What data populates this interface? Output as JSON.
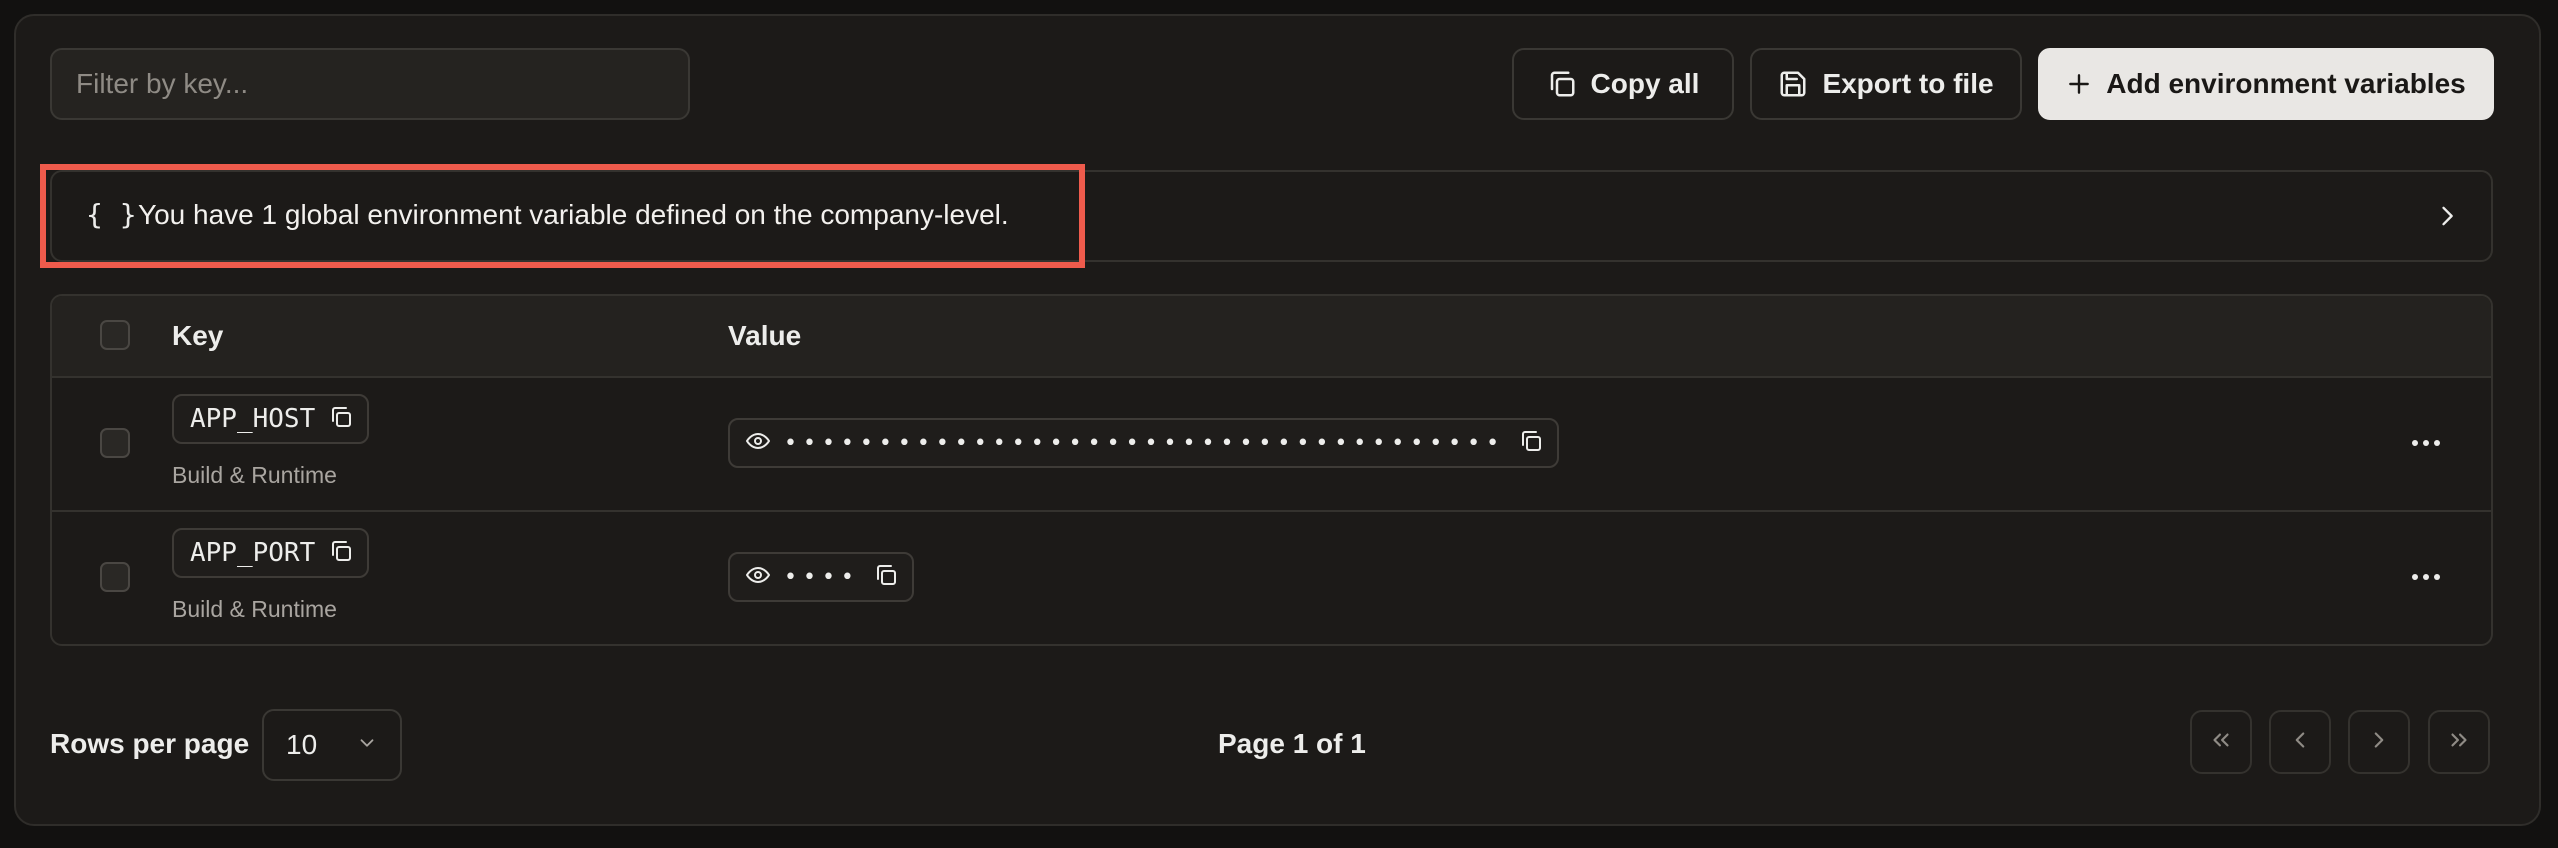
{
  "toolbar": {
    "filter_placeholder": "Filter by key...",
    "copy_all_label": "Copy all",
    "export_label": "Export to file",
    "add_label": "Add environment variables"
  },
  "banner": {
    "icon_text": "{ }",
    "message": "You have 1 global environment variable defined on the company-level."
  },
  "table": {
    "headers": {
      "key": "Key",
      "value": "Value"
    },
    "rows": [
      {
        "key": "APP_HOST",
        "scope": "Build & Runtime",
        "masked_value": "••••••••••••••••••••••••••••••••••••••"
      },
      {
        "key": "APP_PORT",
        "scope": "Build & Runtime",
        "masked_value": "••••"
      }
    ]
  },
  "pagination": {
    "rows_per_page_label": "Rows per page",
    "rows_per_page_value": "10",
    "page_info": "Page 1 of 1"
  },
  "colors": {
    "background": "#1c1a18",
    "highlight": "#ef5b4c",
    "primary_button": "#e9e7e4"
  }
}
